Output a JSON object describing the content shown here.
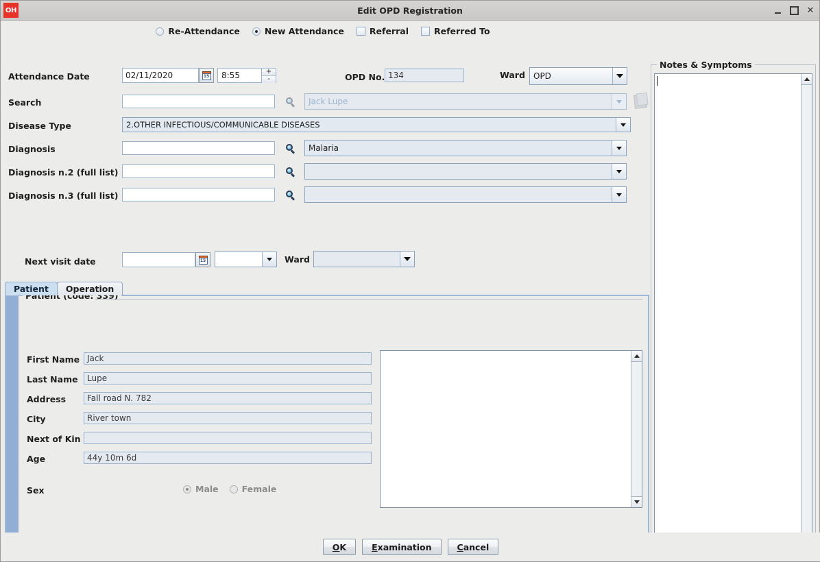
{
  "window": {
    "title": "Edit OPD Registration",
    "app_badge": "OH",
    "controls": {
      "minimize": "_",
      "maximize": "□",
      "close": "✕"
    }
  },
  "attendance": {
    "options": [
      {
        "label": "Re-Attendance",
        "type": "radio",
        "selected": false
      },
      {
        "label": "New Attendance",
        "type": "radio",
        "selected": true
      },
      {
        "label": "Referral",
        "type": "checkbox",
        "checked": false
      },
      {
        "label": "Referred To",
        "type": "checkbox",
        "checked": false
      }
    ]
  },
  "form": {
    "attendance_date_label": "Attendance Date",
    "attendance_date_value": "02/11/2020",
    "attendance_time_value": "8:55",
    "spinner_up": "+",
    "spinner_down": "-",
    "opd_no_label": "OPD No.",
    "opd_no_value": "134",
    "ward_label": "Ward",
    "ward_value": "OPD",
    "search_label": "Search",
    "search_value": "",
    "search_patient_value": "Jack Lupe",
    "disease_type_label": "Disease Type",
    "disease_type_value": "2.OTHER INFECTIOUS/COMMUNICABLE DISEASES",
    "diagnosis_label": "Diagnosis",
    "diagnosis_code_value": "",
    "diagnosis_value": "Malaria",
    "diagnosis2_label": "Diagnosis n.2 (full list)",
    "diagnosis2_code_value": "",
    "diagnosis2_value": "",
    "diagnosis3_label": "Diagnosis n.3 (full list)",
    "diagnosis3_code_value": "",
    "diagnosis3_value": "",
    "next_visit_label": "Next visit date",
    "next_visit_date_value": "",
    "next_visit_time_value": "",
    "next_visit_ward_label": "Ward",
    "next_visit_ward_value": "",
    "calendar_icon_day": "15"
  },
  "notes": {
    "group_title": "Notes & Symptoms",
    "text": ""
  },
  "tabs": [
    {
      "label": "Patient",
      "active": true
    },
    {
      "label": "Operation",
      "active": false
    }
  ],
  "patient": {
    "group_title": "Patient (code: 339)",
    "fields": [
      {
        "label": "First Name",
        "value": "Jack"
      },
      {
        "label": "Last Name",
        "value": "Lupe"
      },
      {
        "label": "Address",
        "value": "Fall road N. 782"
      },
      {
        "label": "City",
        "value": "River town"
      },
      {
        "label": "Next of Kin",
        "value": ""
      },
      {
        "label": "Age",
        "value": "44y 10m 6d"
      }
    ],
    "sex_label": "Sex",
    "sex_options": [
      {
        "label": "Male",
        "selected": true
      },
      {
        "label": "Female",
        "selected": false
      }
    ],
    "photo_text": ""
  },
  "buttons": [
    {
      "label": "OK",
      "mnemonic": "O"
    },
    {
      "label": "Examination",
      "mnemonic": "E"
    },
    {
      "label": "Cancel",
      "mnemonic": "C"
    }
  ],
  "colors": {
    "accent": "#93aed4",
    "app_badge": "#e8332a",
    "tab_active": "#ccdff0",
    "window_bg": "#ececeb"
  }
}
